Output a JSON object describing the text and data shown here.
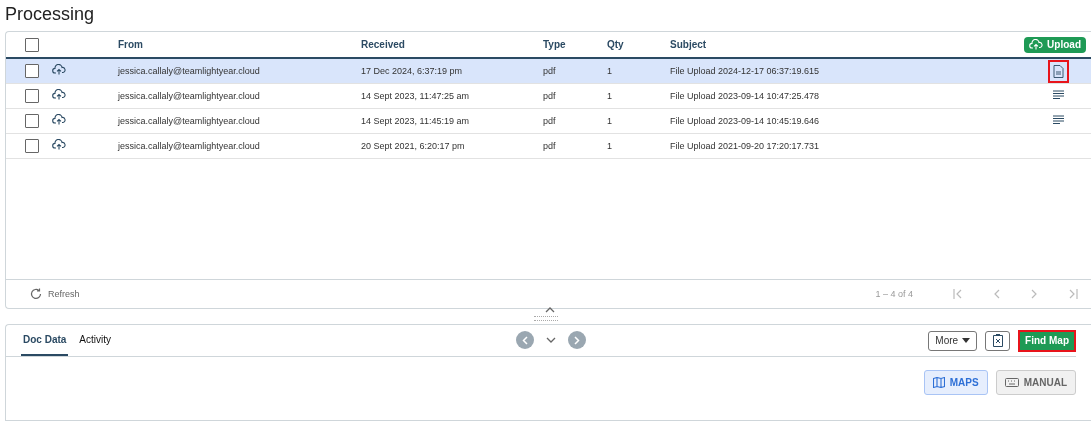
{
  "title": "Processing",
  "table": {
    "select_all_checked": false,
    "columns": [
      "From",
      "Received",
      "Type",
      "Qty",
      "Subject"
    ],
    "upload_button": "Upload",
    "rows": [
      {
        "selected": true,
        "checked": false,
        "from": "jessica.callaly@teamlightyear.cloud",
        "received": "17 Dec 2024, 6:37:19 pm",
        "type": "pdf",
        "qty": "1",
        "subject": "File Upload 2024-12-17 06:37:19.615",
        "kind": "pdf",
        "highlighted": true
      },
      {
        "selected": false,
        "checked": false,
        "from": "jessica.callaly@teamlightyear.cloud",
        "received": "14 Sept 2023, 11:47:25 am",
        "type": "pdf",
        "qty": "1",
        "subject": "File Upload 2023-09-14 10:47:25.478",
        "kind": "text",
        "highlighted": false
      },
      {
        "selected": false,
        "checked": false,
        "from": "jessica.callaly@teamlightyear.cloud",
        "received": "14 Sept 2023, 11:45:19 am",
        "type": "pdf",
        "qty": "1",
        "subject": "File Upload 2023-09-14 10:45:19.646",
        "kind": "text",
        "highlighted": false
      },
      {
        "selected": false,
        "checked": false,
        "from": "jessica.callaly@teamlightyear.cloud",
        "received": "20 Sept 2021, 6:20:17 pm",
        "type": "pdf",
        "qty": "1",
        "subject": "File Upload 2021-09-20 17:20:17.731",
        "kind": "none",
        "highlighted": false
      }
    ],
    "refresh": "Refresh",
    "range": "1 – 4 of 4"
  },
  "detail": {
    "tabs": [
      {
        "label": "Doc Data",
        "selected": true
      },
      {
        "label": "Activity",
        "selected": false
      }
    ],
    "more": "More",
    "find_map": {
      "label": "Find Map",
      "highlighted": true
    },
    "modes": [
      {
        "label": "MAPS",
        "selected": true,
        "kind": "maps"
      },
      {
        "label": "MANUAL",
        "selected": false,
        "kind": "manual"
      }
    ]
  }
}
